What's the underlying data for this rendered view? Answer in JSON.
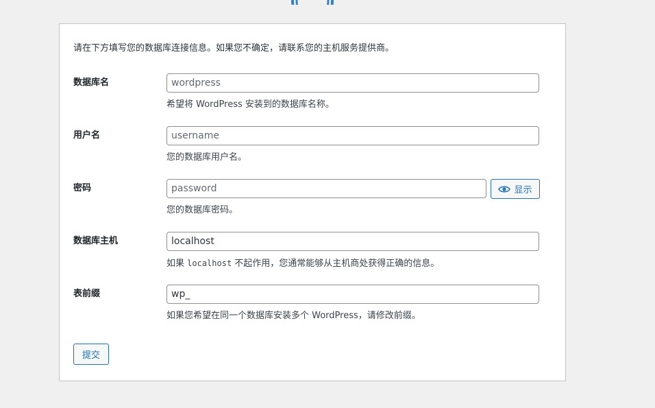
{
  "intro": "请在下方填写您的数据库连接信息。如果您不确定，请联系您的主机服务提供商。",
  "fields": {
    "dbname": {
      "label": "数据库名",
      "value": "",
      "placeholder": "wordpress",
      "description": "希望将 WordPress 安装到的数据库名称。"
    },
    "username": {
      "label": "用户名",
      "value": "",
      "placeholder": "username",
      "description": "您的数据库用户名。"
    },
    "password": {
      "label": "密码",
      "value": "",
      "placeholder": "password",
      "description": "您的数据库密码。",
      "show_button_label": "显示"
    },
    "dbhost": {
      "label": "数据库主机",
      "value": "localhost",
      "placeholder": "",
      "description_prefix": "如果 ",
      "description_code": "localhost",
      "description_suffix": " 不起作用，您通常能够从主机商处获得正确的信息。"
    },
    "prefix": {
      "label": "表前缀",
      "value": "wp_",
      "placeholder": "",
      "description": "如果您希望在同一个数据库安装多个 WordPress，请修改前缀。"
    }
  },
  "submit_label": "提交",
  "icons": {
    "logo": "wordpress-logo-icon",
    "show_password": "eye-icon"
  },
  "colors": {
    "accent": "#2271b1",
    "logo": "#3582c4",
    "background": "#f0f0f1"
  }
}
